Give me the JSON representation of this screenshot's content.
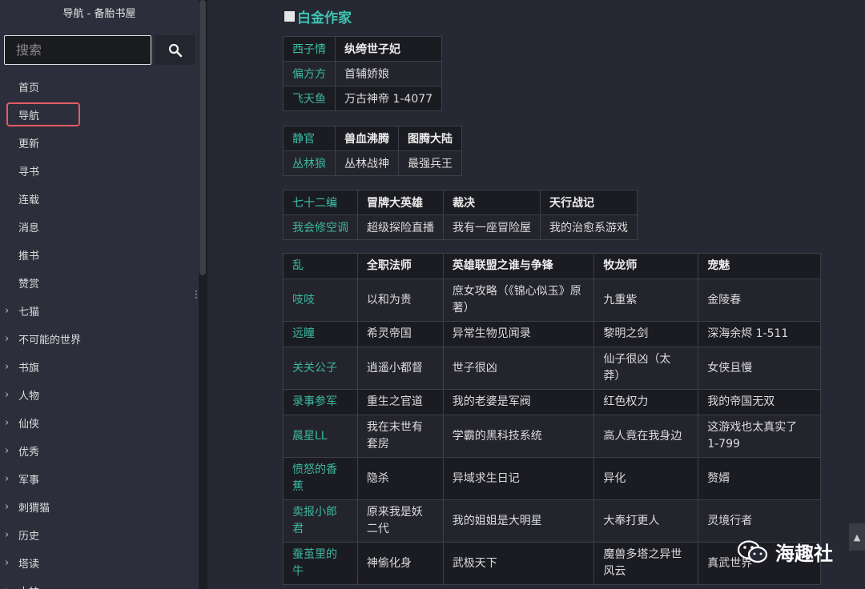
{
  "sidebar": {
    "title": "导航 - 备胎书屋",
    "search": {
      "placeholder": "搜索",
      "value": ""
    },
    "items": [
      {
        "label": "首页",
        "expandable": false
      },
      {
        "label": "导航",
        "expandable": false,
        "active": true
      },
      {
        "label": "更新",
        "expandable": false
      },
      {
        "label": "寻书",
        "expandable": false
      },
      {
        "label": "连载",
        "expandable": false
      },
      {
        "label": "消息",
        "expandable": false
      },
      {
        "label": "推书",
        "expandable": false
      },
      {
        "label": "赞赏",
        "expandable": false
      },
      {
        "label": "七猫",
        "expandable": true
      },
      {
        "label": "不可能的世界",
        "expandable": true
      },
      {
        "label": "书旗",
        "expandable": true
      },
      {
        "label": "人物",
        "expandable": true
      },
      {
        "label": "仙侠",
        "expandable": true
      },
      {
        "label": "优秀",
        "expandable": true
      },
      {
        "label": "军事",
        "expandable": true
      },
      {
        "label": "刺猬猫",
        "expandable": true
      },
      {
        "label": "历史",
        "expandable": true
      },
      {
        "label": "塔读",
        "expandable": true
      },
      {
        "label": "大神",
        "expandable": true
      }
    ],
    "chevron": "›"
  },
  "main": {
    "heading": "白金作家",
    "tables": [
      {
        "rows": [
          [
            "西子情",
            "纨绔世子妃"
          ],
          [
            "偏方方",
            "首辅娇娘"
          ],
          [
            "飞天鱼",
            "万古神帝 1-4077"
          ]
        ]
      },
      {
        "rows": [
          [
            "静官",
            "兽血沸腾",
            "图腾大陆"
          ],
          [
            "丛林狼",
            "丛林战神",
            "最强兵王"
          ]
        ]
      },
      {
        "rows": [
          [
            "七十二编",
            "冒牌大英雄",
            "裁决",
            "天行战记"
          ],
          [
            "我会修空调",
            "超级探险直播",
            "我有一座冒险屋",
            "我的治愈系游戏"
          ]
        ]
      },
      {
        "rows": [
          [
            "乱",
            "全职法师",
            "英雄联盟之谁与争锋",
            "牧龙师",
            "宠魅"
          ],
          [
            "吱吱",
            "以和为贵",
            "庶女攻略（《锦心似玉》原著）",
            "九重紫",
            "金陵春"
          ],
          [
            "远瞳",
            "希灵帝国",
            "异常生物见闻录",
            "黎明之剑",
            "深海余烬 1-511"
          ],
          [
            "关关公子",
            "逍遥小都督",
            "世子很凶",
            "仙子很凶（太 莽）",
            "女侠且慢"
          ],
          [
            "录事参军",
            "重生之官道",
            "我的老婆是军阀",
            "红色权力",
            "我的帝国无双"
          ],
          [
            "晨星LL",
            "我在末世有套房",
            "学霸的黑科技系统",
            "高人竟在我身边",
            "这游戏也太真实了 1-799"
          ],
          [
            "愤怒的香蕉",
            "隐杀",
            "异域求生日记",
            "异化",
            "赘婿"
          ],
          [
            "卖报小郎君",
            "原来我是妖二代",
            "我的姐姐是大明星",
            "大奉打更人",
            "灵境行者"
          ],
          [
            "蚕茧里的牛",
            "神偷化身",
            "武极天下",
            "魔兽多塔之异世风云",
            "真武世界"
          ]
        ]
      }
    ]
  },
  "watermark": {
    "text": "海趣社",
    "icon": "wechat-icon"
  },
  "scroll_top_icon": "arrow-up-icon",
  "colors": {
    "accent": "#3cb79f",
    "active_border": "#e25c63"
  }
}
